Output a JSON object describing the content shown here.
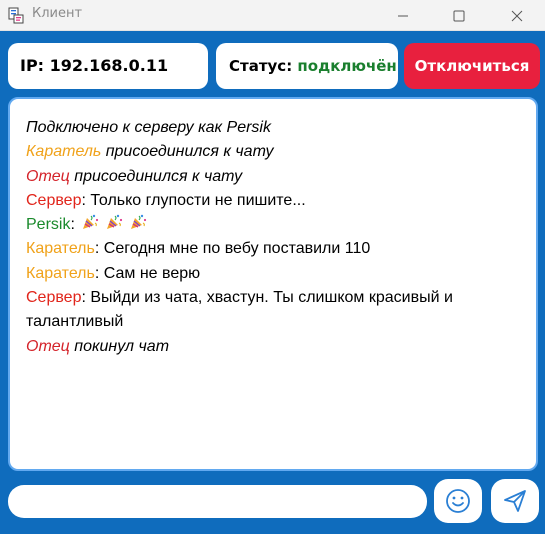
{
  "window": {
    "title": "Клиент"
  },
  "header": {
    "ip_label": "IP:",
    "ip_value": "192.168.0.11",
    "status_label": "Статус:",
    "status_value": "подключён",
    "disconnect_label": "Отключиться"
  },
  "chat": {
    "messages": [
      {
        "type": "system",
        "text": "Подключено к серверу как Persik"
      },
      {
        "type": "system",
        "user": "Каратель",
        "text": " присоединился к чату"
      },
      {
        "type": "system",
        "user": "Отец",
        "text": " присоединился к чату"
      },
      {
        "type": "message",
        "user": "Сервер",
        "sep": ":",
        "text": " Только глупости не пишите..."
      },
      {
        "type": "message",
        "user": "Persik",
        "sep": ":",
        "text": ""
      },
      {
        "type": "message",
        "user": "Каратель",
        "sep": ":",
        "text": " Сегодня мне по вебу поставили 110"
      },
      {
        "type": "message",
        "user": "Каратель",
        "sep": ":",
        "text": " Сам не верю"
      },
      {
        "type": "message",
        "user": "Сервер",
        "sep": ":",
        "text": " Выйди из чата, хвастун. Ты слишком красивый и талантливый"
      },
      {
        "type": "system",
        "user": "Отец",
        "text": " покинул чат"
      }
    ],
    "persik_emojis": [
      "party-popper-icon",
      "party-popper-icon",
      "party-popper-icon"
    ]
  },
  "composer": {
    "placeholder": "",
    "value": "",
    "emoji_button_icon": "smiley-icon",
    "send_button_icon": "paper-plane-icon"
  },
  "colors": {
    "background": "#0f6cbd",
    "disconnect": "#e8203e",
    "status_connected": "#1a7f2e",
    "user_karatel": "#f0a21a",
    "user_otets": "#d4232a",
    "user_server": "#e1251b",
    "user_persik": "#1a8a2c"
  }
}
